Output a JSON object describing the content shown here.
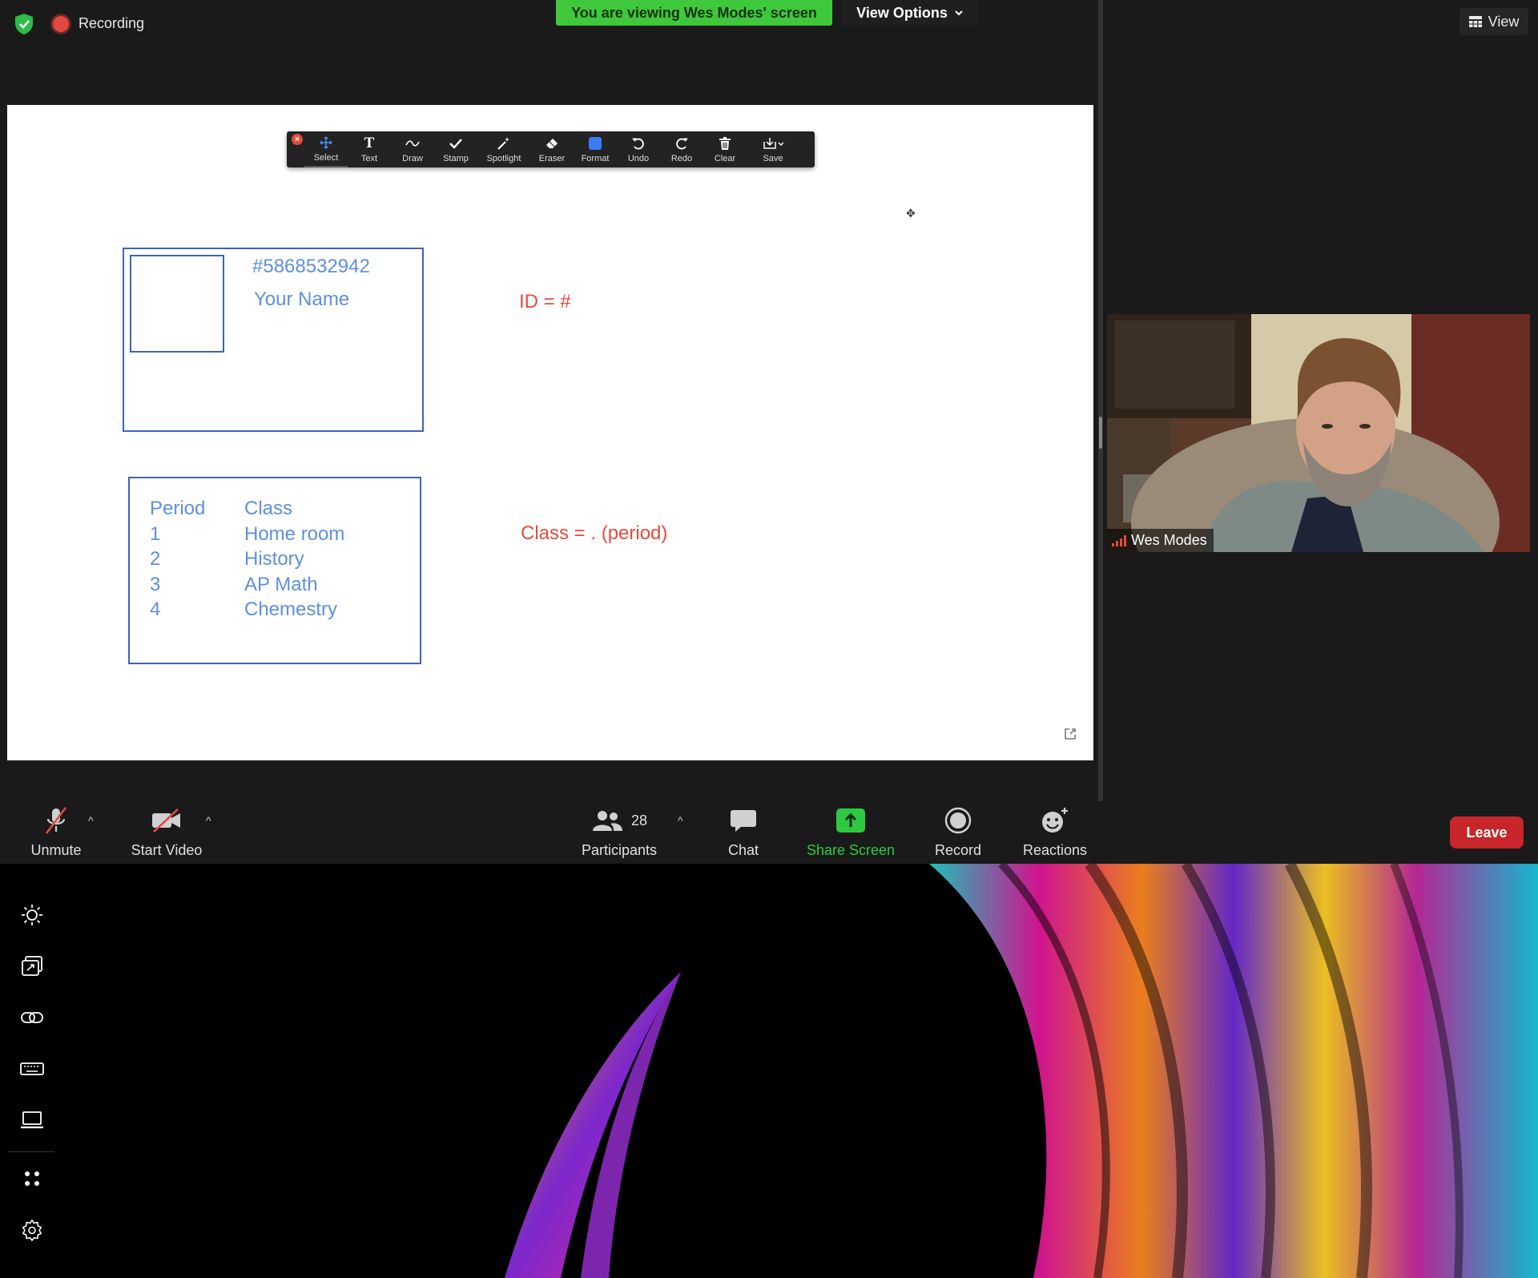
{
  "top_bar": {
    "recording_label": "Recording",
    "viewing_banner": "You are viewing Wes Modes' screen",
    "view_options_label": "View Options",
    "view_label": "View"
  },
  "annotation_toolbar": {
    "tools": [
      {
        "label": "Select",
        "icon": "move-arrows-icon"
      },
      {
        "label": "Text",
        "icon": "text-T-icon"
      },
      {
        "label": "Draw",
        "icon": "squiggle-icon"
      },
      {
        "label": "Stamp",
        "icon": "checkmark-icon"
      },
      {
        "label": "Spotlight",
        "icon": "magic-wand-icon"
      },
      {
        "label": "Eraser",
        "icon": "eraser-icon"
      },
      {
        "label": "Format",
        "icon": "color-square-icon"
      },
      {
        "label": "Undo",
        "icon": "undo-icon"
      },
      {
        "label": "Redo",
        "icon": "redo-icon"
      },
      {
        "label": "Clear",
        "icon": "trash-icon"
      },
      {
        "label": "Save",
        "icon": "save-icon"
      }
    ],
    "format_color": "#3b7df0"
  },
  "whiteboard": {
    "id_card": {
      "number": "#5868532942",
      "name": "Your Name"
    },
    "id_note": "ID = #",
    "class_table": {
      "headers": [
        "Period",
        "Class"
      ],
      "rows": [
        [
          "1",
          "Home room"
        ],
        [
          "2",
          "History"
        ],
        [
          "3",
          "AP Math"
        ],
        [
          "4",
          "Chemestry"
        ]
      ]
    },
    "class_note": "Class = . (period)",
    "ink_blue": "#5e8fe1",
    "ink_red": "#e74b3c"
  },
  "video_tile": {
    "participant_name": "Wes Modes"
  },
  "bottom_toolbar": {
    "unmute_label": "Unmute",
    "start_video_label": "Start Video",
    "participants_label": "Participants",
    "participants_count": "28",
    "chat_label": "Chat",
    "share_screen_label": "Share Screen",
    "record_label": "Record",
    "reactions_label": "Reactions",
    "leave_label": "Leave",
    "share_color": "#2dc941",
    "leave_color": "#c8262a"
  },
  "desktop": {
    "side_icons": [
      "brightness-icon",
      "screenshot-icon",
      "link-icon",
      "keyboard-icon",
      "laptop-icon",
      "dots-grid-icon",
      "settings-gear-icon"
    ]
  }
}
